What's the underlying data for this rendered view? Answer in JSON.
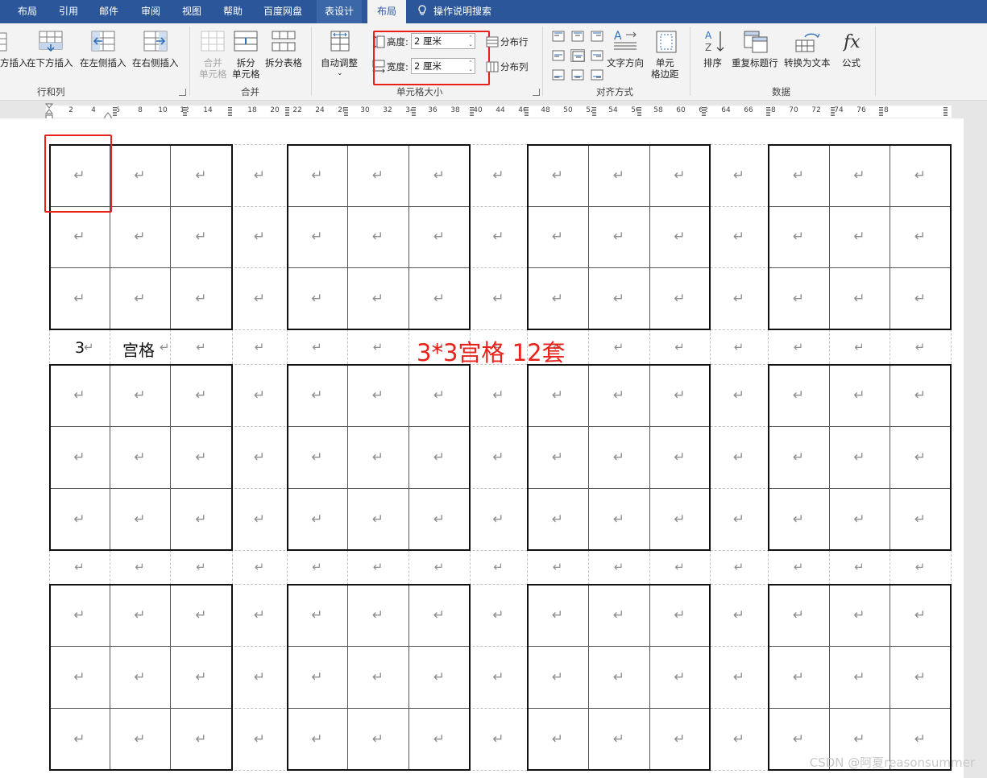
{
  "tabs": [
    "布局",
    "引用",
    "邮件",
    "审阅",
    "视图",
    "帮助",
    "百度网盘",
    "表设计",
    "布局"
  ],
  "search_tab": "操作说明搜索",
  "ribbon": {
    "rows_cols": {
      "insert_above_partial": "方插入",
      "insert_below": "在下方插入",
      "insert_left": "在左侧插入",
      "insert_right": "在右侧插入",
      "group": "行和列"
    },
    "merge": {
      "merge_cells_1": "合并",
      "merge_cells_2": "单元格",
      "split_cells_1": "拆分",
      "split_cells_2": "单元格",
      "split_table": "拆分表格",
      "group": "合并"
    },
    "cell_size": {
      "autofit": "自动调整",
      "height_label": "高度:",
      "height_value": "2 厘米",
      "width_label": "宽度:",
      "width_value": "2 厘米",
      "distribute_rows": "分布行",
      "distribute_cols": "分布列",
      "group": "单元格大小"
    },
    "alignment": {
      "text_direction": "文字方向",
      "cell_margins_1": "单元",
      "cell_margins_2": "格边距",
      "group": "对齐方式"
    },
    "data": {
      "sort": "排序",
      "repeat_header": "重复标题行",
      "convert_text": "转换为文本",
      "formula": "公式",
      "group": "数据"
    }
  },
  "ruler_ticks": [
    "2",
    "4",
    "6",
    "8",
    "10",
    "12",
    "14",
    "18",
    "20",
    "22",
    "24",
    "28",
    "30",
    "32",
    "34",
    "36",
    "38",
    "40",
    "44",
    "46",
    "48",
    "50",
    "52",
    "54",
    "56",
    "58",
    "60",
    "62",
    "64",
    "66",
    "68",
    "70",
    "72",
    "74",
    "76",
    "78"
  ],
  "doc": {
    "label_number": "3",
    "label_text": "宫格",
    "annotation": "3*3宫格 12套",
    "paragraph_mark": "↵"
  },
  "watermark": "CSDN @阿夏reasonsummer",
  "colors": {
    "tabbar": "#2b579a",
    "ribbon_bg": "#f3f3f3",
    "highlight_red": "#e8221b",
    "annotation_red": "#e8221b",
    "paragraph_mark": "#8f8f8f"
  }
}
